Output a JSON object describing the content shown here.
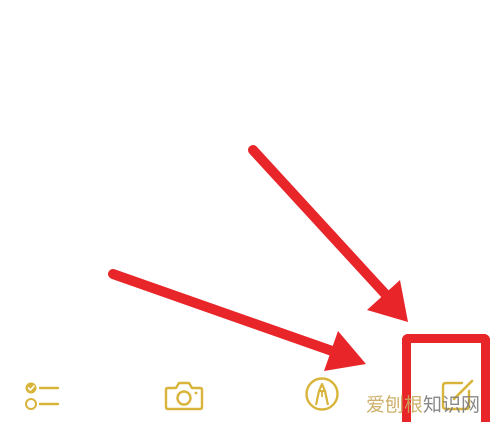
{
  "colors": {
    "accent": "#d9b43a",
    "annotation_red": "#e8262a"
  },
  "toolbar": {
    "items": [
      {
        "name": "checklist",
        "icon": "checklist-icon"
      },
      {
        "name": "camera",
        "icon": "camera-icon"
      },
      {
        "name": "markup",
        "icon": "markup-pen-icon"
      },
      {
        "name": "compose",
        "icon": "compose-icon"
      }
    ]
  },
  "watermark": {
    "part1": "爱刨根",
    "part2": "知识网"
  }
}
